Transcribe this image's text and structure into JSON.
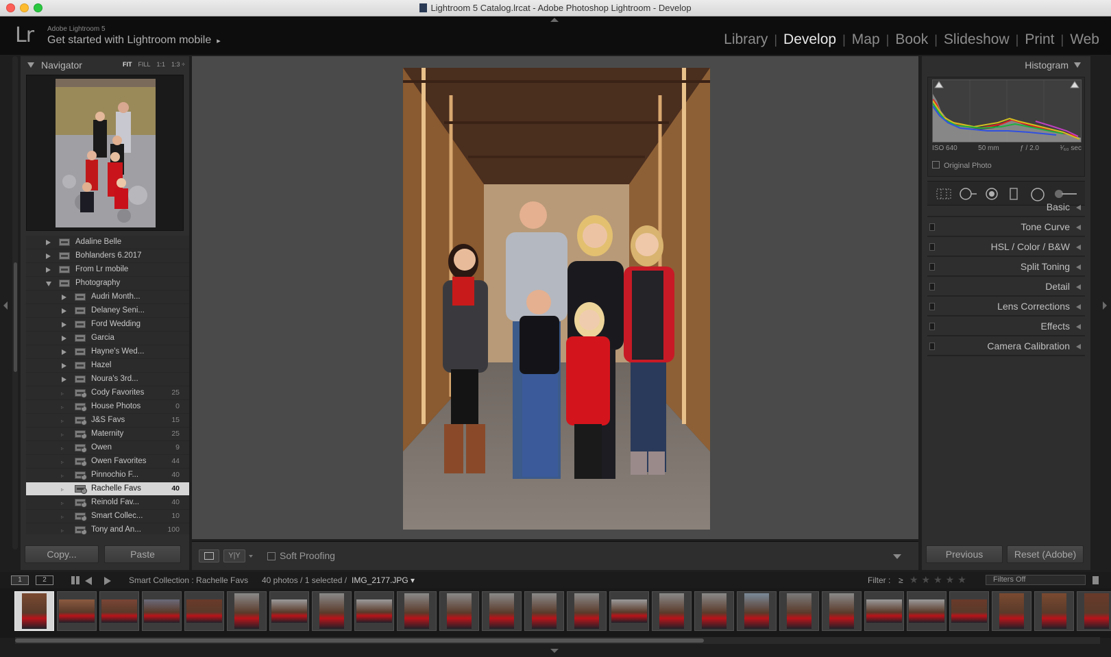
{
  "window": {
    "title": "Lightroom 5 Catalog.lrcat - Adobe Photoshop Lightroom - Develop"
  },
  "identity": {
    "logo": "Lr",
    "small": "Adobe Lightroom 5",
    "main": "Get started with Lightroom mobile",
    "arrow": "▸"
  },
  "modules": [
    {
      "label": "Library",
      "active": false
    },
    {
      "label": "Develop",
      "active": true
    },
    {
      "label": "Map",
      "active": false
    },
    {
      "label": "Book",
      "active": false
    },
    {
      "label": "Slideshow",
      "active": false
    },
    {
      "label": "Print",
      "active": false
    },
    {
      "label": "Web",
      "active": false
    }
  ],
  "navigator": {
    "title": "Navigator",
    "zoom": [
      "FIT",
      "FILL",
      "1:1",
      "1:3 ÷"
    ]
  },
  "folders": [
    {
      "label": "Adaline Belle",
      "count": "",
      "level": 0,
      "type": "folder",
      "state": "closed"
    },
    {
      "label": "Bohlanders 6.2017",
      "count": "",
      "level": 0,
      "type": "folder",
      "state": "closed"
    },
    {
      "label": "From Lr mobile",
      "count": "",
      "level": 0,
      "type": "folder",
      "state": "closed"
    },
    {
      "label": "Photography",
      "count": "",
      "level": 0,
      "type": "folder",
      "state": "open"
    },
    {
      "label": "Audri Month...",
      "count": "",
      "level": 1,
      "type": "folder",
      "state": "closed"
    },
    {
      "label": "Delaney Seni...",
      "count": "",
      "level": 1,
      "type": "folder",
      "state": "closed"
    },
    {
      "label": "Ford Wedding",
      "count": "",
      "level": 1,
      "type": "folder",
      "state": "closed"
    },
    {
      "label": "Garcia",
      "count": "",
      "level": 1,
      "type": "folder",
      "state": "closed"
    },
    {
      "label": "Hayne's Wed...",
      "count": "",
      "level": 1,
      "type": "folder",
      "state": "closed"
    },
    {
      "label": "Hazel",
      "count": "",
      "level": 1,
      "type": "folder",
      "state": "closed"
    },
    {
      "label": "Noura's 3rd...",
      "count": "",
      "level": 1,
      "type": "folder",
      "state": "closed"
    },
    {
      "label": "Cody Favorites",
      "count": "25",
      "level": 1,
      "type": "smart",
      "state": "none"
    },
    {
      "label": "House Photos",
      "count": "0",
      "level": 1,
      "type": "smart",
      "state": "none"
    },
    {
      "label": "J&S Favs",
      "count": "15",
      "level": 1,
      "type": "smart",
      "state": "none"
    },
    {
      "label": "Maternity",
      "count": "25",
      "level": 1,
      "type": "smart",
      "state": "none"
    },
    {
      "label": "Owen",
      "count": "9",
      "level": 1,
      "type": "smart",
      "state": "none"
    },
    {
      "label": "Owen Favorites",
      "count": "44",
      "level": 1,
      "type": "smart",
      "state": "none"
    },
    {
      "label": "Pinnochio F...",
      "count": "40",
      "level": 1,
      "type": "smart",
      "state": "none"
    },
    {
      "label": "Rachelle Favs",
      "count": "40",
      "level": 1,
      "type": "smart",
      "state": "selected"
    },
    {
      "label": "Reinold Fav...",
      "count": "40",
      "level": 1,
      "type": "smart",
      "state": "none"
    },
    {
      "label": "Smart Collec...",
      "count": "10",
      "level": 1,
      "type": "smart",
      "state": "none"
    },
    {
      "label": "Tony and An...",
      "count": "100",
      "level": 1,
      "type": "smart",
      "state": "none"
    }
  ],
  "left_buttons": {
    "copy": "Copy...",
    "paste": "Paste"
  },
  "toolbar": {
    "soft_proofing": "Soft Proofing",
    "compare": "Y|Y"
  },
  "histogram": {
    "title": "Histogram",
    "iso": "ISO 640",
    "focal": "50 mm",
    "aperture": "ƒ / 2.0",
    "shutter": "¹⁄₆₀ sec",
    "original": "Original Photo"
  },
  "right_sections": [
    {
      "label": "Basic",
      "toggle": false
    },
    {
      "label": "Tone Curve",
      "toggle": true
    },
    {
      "label": "HSL / Color / B&W",
      "toggle": true
    },
    {
      "label": "Split Toning",
      "toggle": true
    },
    {
      "label": "Detail",
      "toggle": true
    },
    {
      "label": "Lens Corrections",
      "toggle": true
    },
    {
      "label": "Effects",
      "toggle": true
    },
    {
      "label": "Camera Calibration",
      "toggle": true
    }
  ],
  "right_buttons": {
    "previous": "Previous",
    "reset": "Reset (Adobe)"
  },
  "filmstrip_bar": {
    "screen1": "1",
    "screen2": "2",
    "source": "Smart Collection : Rachelle Favs",
    "count": "40 photos / 1 selected /",
    "filename": "IMG_2177.JPG ▾",
    "filter_label": "Filter :",
    "filter_op": "≥",
    "stars": "★★★★★",
    "filter_value": "Filters Off"
  },
  "filmstrip": {
    "thumbs": [
      {
        "orientation": "portrait",
        "tone": "#7a4a30",
        "selected": true
      },
      {
        "orientation": "landscape",
        "tone": "#8a5a40",
        "selected": false
      },
      {
        "orientation": "landscape",
        "tone": "#7a4535",
        "selected": false
      },
      {
        "orientation": "landscape",
        "tone": "#6a6a7a",
        "selected": false
      },
      {
        "orientation": "landscape",
        "tone": "#6a3a2a",
        "selected": false
      },
      {
        "orientation": "portrait",
        "tone": "#8a8a8a",
        "selected": false
      },
      {
        "orientation": "landscape",
        "tone": "#9a9a9a",
        "selected": false
      },
      {
        "orientation": "portrait",
        "tone": "#8a8a8a",
        "selected": false
      },
      {
        "orientation": "landscape",
        "tone": "#9a9a9a",
        "selected": false
      },
      {
        "orientation": "portrait",
        "tone": "#8a8a8a",
        "selected": false
      },
      {
        "orientation": "portrait",
        "tone": "#8a8a8a",
        "selected": false
      },
      {
        "orientation": "portrait",
        "tone": "#8a8a8a",
        "selected": false
      },
      {
        "orientation": "portrait",
        "tone": "#8a8a8a",
        "selected": false
      },
      {
        "orientation": "portrait",
        "tone": "#8a8a8a",
        "selected": false
      },
      {
        "orientation": "landscape",
        "tone": "#9a9a9a",
        "selected": false
      },
      {
        "orientation": "portrait",
        "tone": "#8a8a8a",
        "selected": false
      },
      {
        "orientation": "portrait",
        "tone": "#8a8a8a",
        "selected": false
      },
      {
        "orientation": "portrait",
        "tone": "#7a8a9a",
        "selected": false
      },
      {
        "orientation": "portrait",
        "tone": "#7a7a7a",
        "selected": false
      },
      {
        "orientation": "portrait",
        "tone": "#8a8a8a",
        "selected": false
      },
      {
        "orientation": "landscape",
        "tone": "#9a9a9a",
        "selected": false
      },
      {
        "orientation": "landscape",
        "tone": "#9a9a9a",
        "selected": false
      },
      {
        "orientation": "landscape",
        "tone": "#6a3a2a",
        "selected": false
      },
      {
        "orientation": "portrait",
        "tone": "#7a4a30",
        "selected": false
      },
      {
        "orientation": "portrait",
        "tone": "#7a4a30",
        "selected": false
      },
      {
        "orientation": "portrait",
        "tone": "#6a3a2a",
        "selected": false
      }
    ]
  }
}
